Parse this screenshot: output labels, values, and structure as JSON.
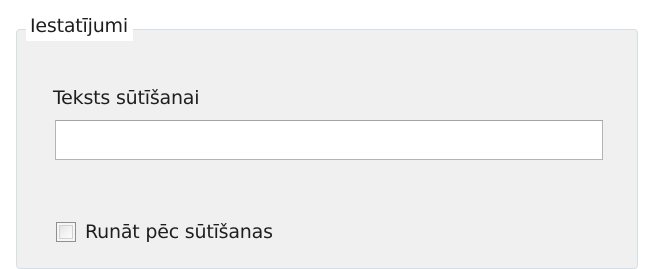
{
  "settings_group": {
    "title": "Iestatījumi"
  },
  "send_text": {
    "label": "Teksts sūtīšanai",
    "value": "",
    "placeholder": ""
  },
  "speak_after_send": {
    "label": "Runāt pēc sūtīšanas",
    "checked": false
  }
}
